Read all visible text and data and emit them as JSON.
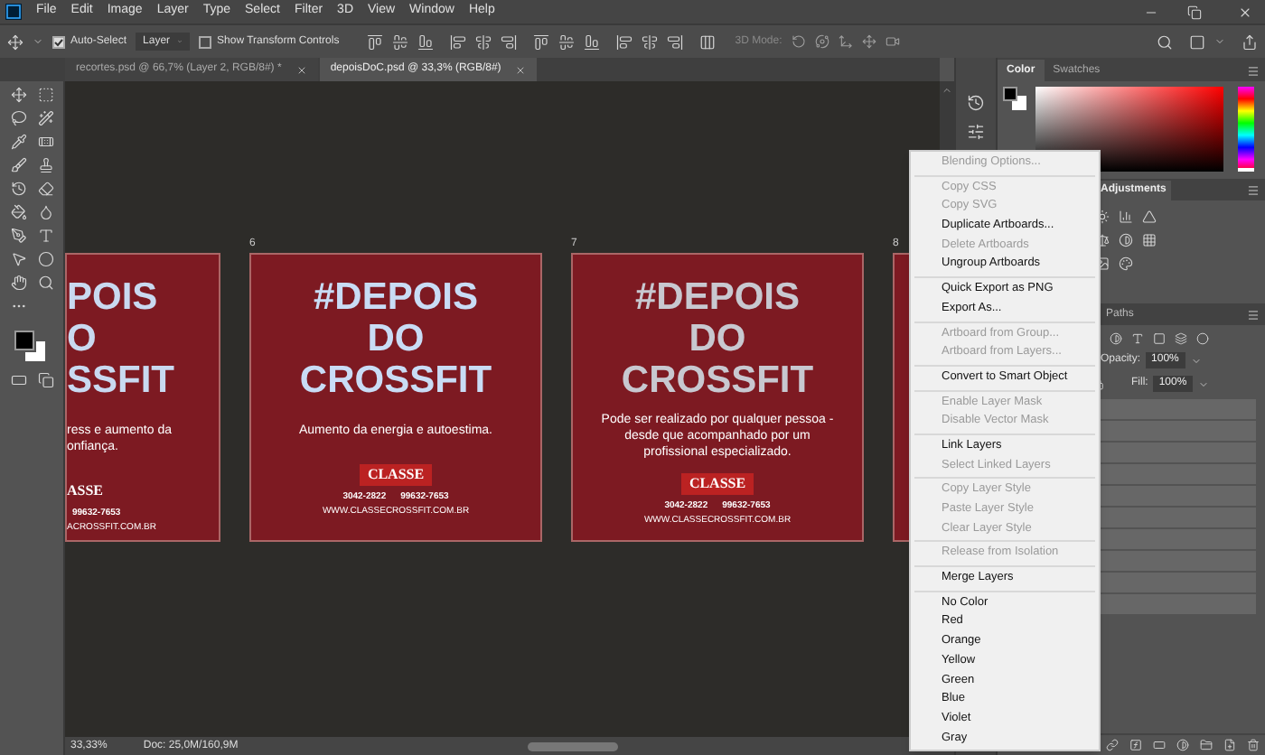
{
  "menu_bar": {
    "items": [
      "File",
      "Edit",
      "Image",
      "Layer",
      "Type",
      "Select",
      "Filter",
      "3D",
      "View",
      "Window",
      "Help"
    ]
  },
  "options_bar": {
    "auto_select": {
      "label": "Auto-Select",
      "checked": true
    },
    "target": "Layer",
    "transform_controls": {
      "label": "Show Transform Controls",
      "checked": false
    },
    "mode_3d": "3D Mode:"
  },
  "document_tabs": [
    {
      "label": "recortes.psd @ 66,7% (Layer 2, RGB/8#) *",
      "selected": false
    },
    {
      "label": "depoisDoC.psd @ 33,3% (RGB/8#)",
      "selected": true
    }
  ],
  "artboards": [
    {
      "kind": "cut",
      "headline": [
        "POIS",
        "O",
        "SSFIT"
      ],
      "caption_lines": [
        "ress e aumento da",
        "onfiança."
      ],
      "logo": "ASSE",
      "phones": [
        "99632-7653"
      ],
      "website": "ACROSSFIT.COM.BR"
    },
    {
      "kind": "full",
      "number": "6",
      "headline": [
        "#DEPOIS",
        "DO",
        "CROSSFIT"
      ],
      "caption_lines": [
        "Aumento da energia e autoestima."
      ],
      "logo": "CLASSE",
      "phones": [
        "3042-2822",
        "99632-7653"
      ],
      "website": "WWW.CLASSECROSSFIT.COM.BR"
    },
    {
      "kind": "full",
      "number": "7",
      "headline": [
        "#DEPOIS",
        "DO",
        "CROSSFIT"
      ],
      "caption_lines": [
        "Pode ser realizado por qualquer pessoa -",
        "desde que acompanhado por um",
        "profissional especializado."
      ],
      "logo": "CLASSE",
      "phones": [
        "3042-2822",
        "99632-7653"
      ],
      "website": "WWW.CLASSECROSSFIT.COM.BR"
    },
    {
      "kind": "sliver",
      "number": "8"
    }
  ],
  "panels": {
    "color_tabs": [
      {
        "label": "Color",
        "selected": true
      },
      {
        "label": "Swatches",
        "selected": false
      }
    ],
    "hue_slider": {
      "level": 0
    },
    "adjustments_tab": "Adjustments",
    "layers_tab": "Paths",
    "opacity": {
      "label": "Opacity:",
      "value": "100%"
    },
    "fill": {
      "label": "Fill:",
      "value": "100%"
    }
  },
  "context_menu": {
    "groups": [
      [
        {
          "label": "Blending Options...",
          "disabled": true
        }
      ],
      [
        {
          "label": "Copy CSS",
          "disabled": true
        },
        {
          "label": "Copy SVG",
          "disabled": true
        },
        {
          "label": "Duplicate Artboards...",
          "disabled": false
        },
        {
          "label": "Delete Artboards",
          "disabled": true
        },
        {
          "label": "Ungroup Artboards",
          "disabled": false
        }
      ],
      [
        {
          "label": "Quick Export as PNG",
          "disabled": false
        },
        {
          "label": "Export As...",
          "disabled": false
        }
      ],
      [
        {
          "label": "Artboard from Group...",
          "disabled": true
        },
        {
          "label": "Artboard from Layers...",
          "disabled": true
        }
      ],
      [
        {
          "label": "Convert to Smart Object",
          "disabled": false
        }
      ],
      [
        {
          "label": "Enable Layer Mask",
          "disabled": true
        },
        {
          "label": "Disable Vector Mask",
          "disabled": true
        }
      ],
      [
        {
          "label": "Link Layers",
          "disabled": false
        },
        {
          "label": "Select Linked Layers",
          "disabled": true
        }
      ],
      [
        {
          "label": "Copy Layer Style",
          "disabled": true
        },
        {
          "label": "Paste Layer Style",
          "disabled": true
        },
        {
          "label": "Clear Layer Style",
          "disabled": true
        }
      ],
      [
        {
          "label": "Release from Isolation",
          "disabled": true
        }
      ],
      [
        {
          "label": "Merge Layers",
          "disabled": false
        }
      ],
      [
        {
          "label": "No Color",
          "disabled": false
        },
        {
          "label": "Red",
          "disabled": false
        },
        {
          "label": "Orange",
          "disabled": false
        },
        {
          "label": "Yellow",
          "disabled": false
        },
        {
          "label": "Green",
          "disabled": false
        },
        {
          "label": "Blue",
          "disabled": false
        },
        {
          "label": "Violet",
          "disabled": false
        },
        {
          "label": "Gray",
          "disabled": false
        }
      ]
    ]
  },
  "status_bar": {
    "zoom": "33,33%",
    "doc": "Doc: 25,0M/160,9M"
  }
}
